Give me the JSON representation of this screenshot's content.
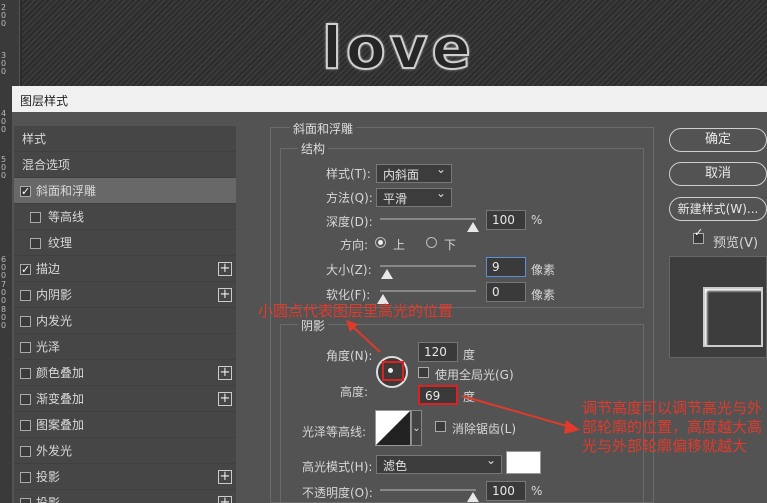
{
  "ruler_top": [
    "200",
    "300"
  ],
  "ruler_left": [
    "400",
    "500",
    "600",
    "700",
    "800"
  ],
  "canvas": {
    "text": "love"
  },
  "dialog": {
    "title": "图层样式"
  },
  "list": {
    "items": [
      {
        "label": "样式",
        "checkbox": false,
        "checked": false,
        "plus": false,
        "sub": false,
        "selected": false
      },
      {
        "label": "混合选项",
        "checkbox": false,
        "checked": false,
        "plus": false,
        "sub": false,
        "selected": false
      },
      {
        "label": "斜面和浮雕",
        "checkbox": true,
        "checked": true,
        "plus": false,
        "sub": false,
        "selected": true
      },
      {
        "label": "等高线",
        "checkbox": true,
        "checked": false,
        "plus": false,
        "sub": true,
        "selected": false
      },
      {
        "label": "纹理",
        "checkbox": true,
        "checked": false,
        "plus": false,
        "sub": true,
        "selected": false
      },
      {
        "label": "描边",
        "checkbox": true,
        "checked": true,
        "plus": true,
        "sub": false,
        "selected": false
      },
      {
        "label": "内阴影",
        "checkbox": true,
        "checked": false,
        "plus": true,
        "sub": false,
        "selected": false
      },
      {
        "label": "内发光",
        "checkbox": true,
        "checked": false,
        "plus": false,
        "sub": false,
        "selected": false
      },
      {
        "label": "光泽",
        "checkbox": true,
        "checked": false,
        "plus": false,
        "sub": false,
        "selected": false
      },
      {
        "label": "颜色叠加",
        "checkbox": true,
        "checked": false,
        "plus": true,
        "sub": false,
        "selected": false
      },
      {
        "label": "渐变叠加",
        "checkbox": true,
        "checked": false,
        "plus": true,
        "sub": false,
        "selected": false
      },
      {
        "label": "图案叠加",
        "checkbox": true,
        "checked": false,
        "plus": false,
        "sub": false,
        "selected": false
      },
      {
        "label": "外发光",
        "checkbox": true,
        "checked": false,
        "plus": false,
        "sub": false,
        "selected": false
      },
      {
        "label": "投影",
        "checkbox": true,
        "checked": false,
        "plus": true,
        "sub": false,
        "selected": false
      },
      {
        "label": "投影",
        "checkbox": true,
        "checked": false,
        "plus": true,
        "sub": false,
        "selected": false
      }
    ]
  },
  "bevel": {
    "group_title": "斜面和浮雕",
    "structure_title": "结构",
    "style_label": "样式(T):",
    "style_value": "内斜面",
    "method_label": "方法(Q):",
    "method_value": "平滑",
    "depth_label": "深度(D):",
    "depth_value": "100",
    "depth_unit": "%",
    "depth_level": 1.0,
    "direction_label": "方向:",
    "direction_up": "上",
    "direction_down": "下",
    "size_label": "大小(Z):",
    "size_value": "9",
    "size_unit": "像素",
    "size_level": 0.04,
    "soften_label": "软化(F):",
    "soften_value": "0",
    "soften_unit": "像素",
    "soften_level": 0.0
  },
  "shading": {
    "title": "阴影",
    "angle_label": "角度(N):",
    "angle_value": "120",
    "angle_unit": "度",
    "global_light_label": "使用全局光(G)",
    "altitude_label": "高度:",
    "altitude_value": "69",
    "altitude_unit": "度",
    "gloss_label": "光泽等高线:",
    "antialias_label": "消除锯齿(L)",
    "highlight_mode_label": "高光模式(H):",
    "highlight_mode_value": "滤色",
    "opacity_label": "不透明度(O):",
    "opacity_value": "100",
    "opacity_unit": "%",
    "opacity_level": 1.0
  },
  "buttons": {
    "ok": "确定",
    "cancel": "取消",
    "new_style": "新建样式(W)...",
    "preview": "预览(V)"
  },
  "annotations": {
    "dot": "小圆点代表图层里高光的位置",
    "altitude": "调节高度可以调节高光与外部轮廓的位置，高度越大高光与外部轮廓偏移就越大"
  },
  "colors": {
    "annotation": "#e03a2c"
  }
}
